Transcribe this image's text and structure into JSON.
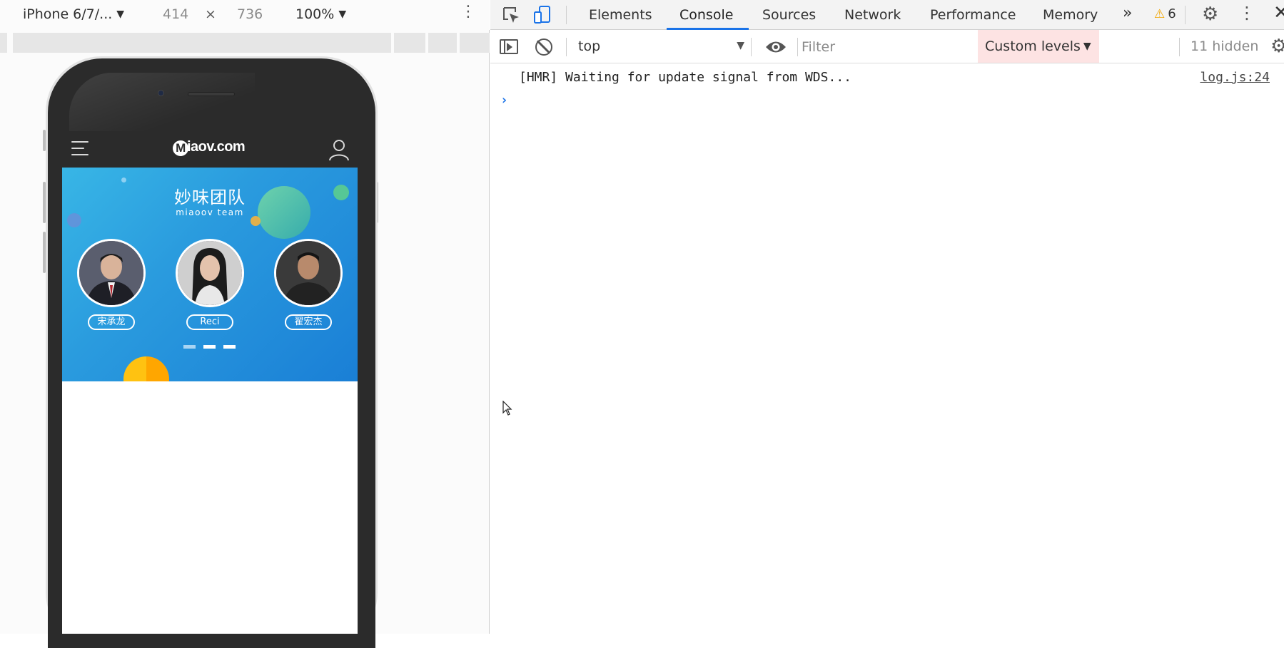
{
  "device_toolbar": {
    "device": "iPhone 6/7/...",
    "width": "414",
    "times": "×",
    "height": "736",
    "zoom": "100%",
    "dropdown_arrow": "▼",
    "menu_glyph": "⋮"
  },
  "app": {
    "logo_badge": "M",
    "logo_text": "iaov.com",
    "banner_title": "妙味团队",
    "banner_subtitle": "miaoov team",
    "members": [
      {
        "name": "宋承龙"
      },
      {
        "name": "Reci"
      },
      {
        "name": "翟宏杰"
      }
    ],
    "carousel": {
      "total": 3,
      "active_index": 0
    }
  },
  "devtools": {
    "tabs": [
      {
        "label": "Elements"
      },
      {
        "label": "Console"
      },
      {
        "label": "Sources"
      },
      {
        "label": "Network"
      },
      {
        "label": "Performance"
      },
      {
        "label": "Memory"
      }
    ],
    "active_tab": "Console",
    "more_tabs_glyph": "»",
    "warning_count": "6",
    "console_toolbar": {
      "context": "top",
      "filter_placeholder": "Filter",
      "levels": "Custom levels",
      "hidden": "11 hidden"
    },
    "console_messages": [
      {
        "text": "[HMR] Waiting for update signal from WDS...",
        "source": "log.js:24"
      }
    ],
    "prompt_glyph": "›"
  },
  "colors": {
    "accent": "#1a73e8",
    "warning": "#f2a600",
    "levels_bg": "#fde3e3",
    "banner_start": "#38b6e6",
    "banner_end": "#1a7fd6",
    "app_header": "#2b2b2b"
  },
  "icons": [
    "inspect-icon",
    "device-toggle-icon",
    "warning-icon",
    "gear-icon",
    "kebab-icon",
    "close-icon",
    "sidebar-toggle-icon",
    "clear-console-icon",
    "eye-icon",
    "hamburger-icon",
    "user-icon"
  ]
}
